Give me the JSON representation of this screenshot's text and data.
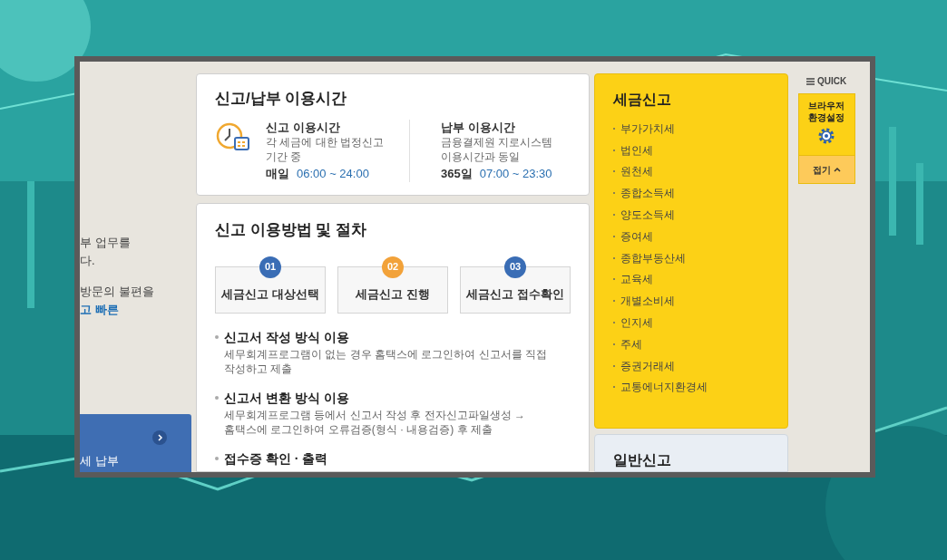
{
  "left_panel": {
    "lines": [
      {
        "text": "부 업무를",
        "kind": "plain"
      },
      {
        "text": "다.",
        "kind": "plain"
      },
      {
        "text": "방문의 불편을",
        "kind": "plain"
      },
      {
        "text": "고 빠른",
        "kind": "link"
      }
    ],
    "card": {
      "text": "세 납부"
    }
  },
  "hours": {
    "title": "신고/납부 이용시간",
    "items": [
      {
        "heading": "신고 이용시간",
        "lines": [
          "각 세금에 대한 법정신고",
          "기간 중"
        ],
        "period": "매일",
        "time": "06:00 ~ 24:00"
      },
      {
        "heading": "납부 이용시간",
        "lines": [
          "금융결제원 지로시스템",
          "이용시간과 동일"
        ],
        "period": "365일",
        "time": "07:00 ~ 23:30"
      }
    ]
  },
  "procedure": {
    "title": "신고 이용방법 및 절차",
    "steps": [
      {
        "number": "01",
        "label": "세금신고 대상선택",
        "color": "#3a6db5"
      },
      {
        "number": "02",
        "label": "세금신고 진행",
        "color": "#f2a23a"
      },
      {
        "number": "03",
        "label": "세금신고 접수확인",
        "color": "#3a6db5"
      }
    ],
    "methods": [
      {
        "title": "신고서 작성 방식 이용",
        "lines": [
          "세무회계프로그램이 없는 경우 홈택스에 로그인하여 신고서를 직접",
          "작성하고 제출"
        ]
      },
      {
        "title": "신고서 변환 방식 이용",
        "lines": [
          "세무회계프로그램 등에서 신고서 작성 후 전자신고파일생성 →",
          "홈택스에 로그인하여 오류검증(형식 · 내용검증) 후 제출"
        ]
      },
      {
        "title": "접수증 확인 · 출력"
      }
    ]
  },
  "tax_filing": {
    "title": "세금신고",
    "items": [
      "부가가치세",
      "법인세",
      "원천세",
      "종합소득세",
      "양도소득세",
      "증여세",
      "종합부동산세",
      "교육세",
      "개별소비세",
      "인지세",
      "주세",
      "증권거래세",
      "교통에너지환경세"
    ]
  },
  "general_filing": {
    "title": "일반신고"
  },
  "quick": {
    "label": "QUICK",
    "settings": [
      "브라우저",
      "환경설정"
    ],
    "collapse": "접기"
  }
}
